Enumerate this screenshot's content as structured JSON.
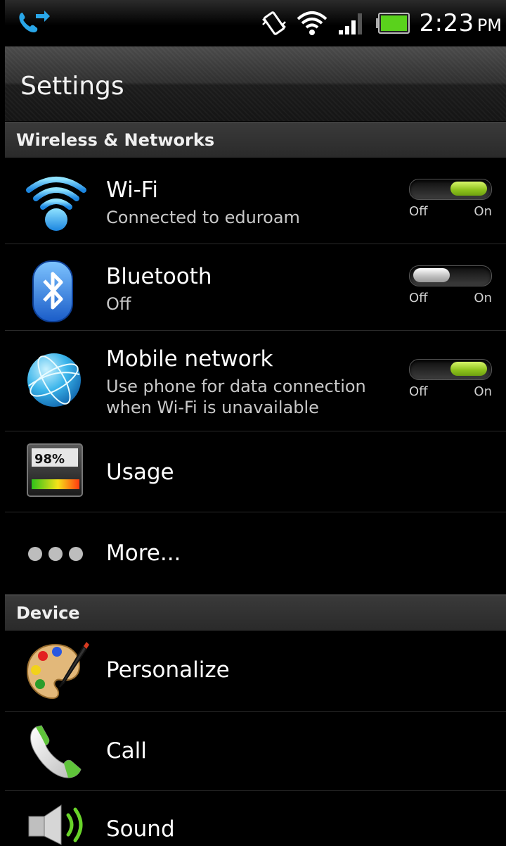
{
  "status_bar": {
    "time": "2:23",
    "ampm": "PM",
    "icons": [
      "call-forward-icon",
      "vibrate-icon",
      "wifi-signal-icon",
      "cell-signal-icon",
      "battery-icon"
    ]
  },
  "title": "Settings",
  "sections": {
    "wireless": "Wireless & Networks",
    "device": "Device"
  },
  "items": {
    "wifi": {
      "label": "Wi-Fi",
      "sub": "Connected to eduroam",
      "toggle": "on"
    },
    "bluetooth": {
      "label": "Bluetooth",
      "sub": "Off",
      "toggle": "off"
    },
    "mobile": {
      "label": "Mobile network",
      "sub1": "Use phone for data connection",
      "sub2": "when Wi-Fi is unavailable",
      "toggle": "on"
    },
    "usage": {
      "label": "Usage",
      "badge": "98%"
    },
    "more": {
      "label": "More..."
    },
    "personalize": {
      "label": "Personalize"
    },
    "call": {
      "label": "Call"
    },
    "sound": {
      "label": "Sound"
    }
  },
  "toggle_labels": {
    "off": "Off",
    "on": "On"
  },
  "colors": {
    "accent_on": "#8dc21c",
    "status_icon": "#29a6e8"
  }
}
